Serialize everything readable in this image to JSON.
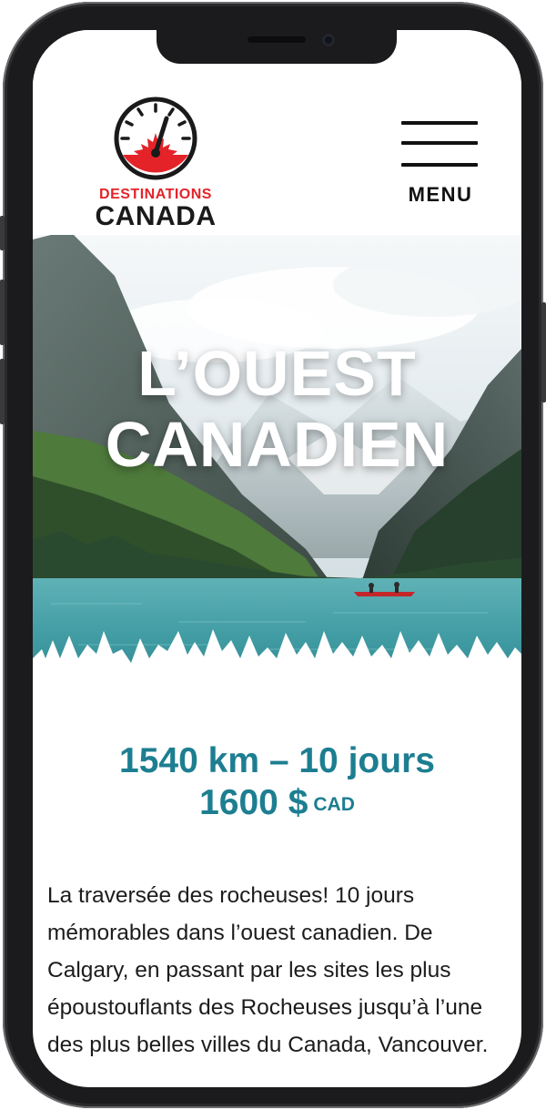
{
  "header": {
    "brand_line1": "DESTINATIONS",
    "brand_line2": "CANADA",
    "menu_label": "MENU"
  },
  "hero": {
    "title_line1": "L’OUEST",
    "title_line2": "CANADIEN"
  },
  "trip": {
    "distance_duration": "1540 km – 10 jours",
    "price": "1600 $",
    "currency": "CAD"
  },
  "description": "La traversée des rocheuses! 10 jours mémorables dans l’ouest canadien. De Calgary, en passant par les sites les plus époustouflants des Rocheuses jusqu’à l’une des plus belles villes du Canada, Vancouver.",
  "colors": {
    "brand_red": "#e42329",
    "accent_teal": "#1d7e91",
    "lake": "#3f9aa2"
  },
  "icons": [
    "speedometer-maple-leaf-logo",
    "hamburger-menu-icon"
  ]
}
